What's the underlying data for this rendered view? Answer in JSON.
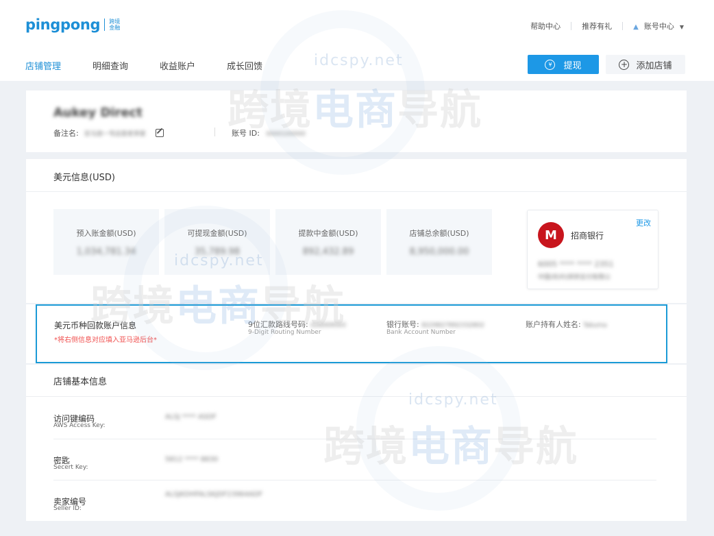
{
  "header": {
    "logo_word": "pingpong",
    "logo_sub": "跨境金融",
    "links": [
      "帮助中心",
      "推荐有礼"
    ],
    "account_menu": "账号中心",
    "nav_tabs": [
      {
        "label": "店铺管理",
        "active": true
      },
      {
        "label": "明细查询",
        "active": false
      },
      {
        "label": "收益账户",
        "active": false
      },
      {
        "label": "成长回馈",
        "active": false
      }
    ],
    "withdraw_label": "提现",
    "add_store_label": "添加店铺"
  },
  "store": {
    "name": "Aukey Direct",
    "remark_label": "备注名:",
    "remark_value": "亚马逊一号店是老李家",
    "account_label": "账号 ID:",
    "account_value": "0000100000"
  },
  "usd": {
    "title": "美元信息(USD)",
    "balances": [
      {
        "label": "预入账金额(USD)",
        "value": "1,034,781.34"
      },
      {
        "label": "可提现金额(USD)",
        "value": "35,789.98"
      },
      {
        "label": "提款中金额(USD)",
        "value": "892,432.89"
      },
      {
        "label": "店铺总余额(USD)",
        "value": "8,950,000.00"
      }
    ],
    "bank": {
      "change_label": "更改",
      "name": "招商银行",
      "number": "6005  ****  ****  2351",
      "sub": "中国(杭州)拼拼支付有限公"
    }
  },
  "receiving": {
    "title": "美元币种回款账户信息",
    "note": "*将右侧信息对应填入亚马逊后台*",
    "fields": [
      {
        "label": "9位汇款路线号码:",
        "value": "026009593",
        "sub": "9-Digit Routing Number"
      },
      {
        "label": "银行账号:",
        "value": "8229827892332802",
        "sub": "Bank Account Number"
      },
      {
        "label": "账户持有人姓名:",
        "value": "Takuma",
        "sub": ""
      }
    ]
  },
  "basic": {
    "title": "店铺基本信息",
    "rows": [
      {
        "label": "访问键编码",
        "sub": "AWS Access Key:",
        "value": "ALSJ ****  ASDF"
      },
      {
        "label": "密匙",
        "sub": "Secert Key:",
        "value": "5812 ****  8830"
      },
      {
        "label": "卖家编号",
        "sub": "Seller ID:",
        "value": "ALSJKDHFALSKJDF23964ADF"
      }
    ]
  },
  "watermark": {
    "domain": "idcspy.net",
    "text_pre": "跨境",
    "text_hl": "电商",
    "text_post": "导航"
  },
  "icons": {
    "withdraw": "yen-circle-icon",
    "add": "plus-circle-icon",
    "user": "user-icon",
    "edit": "edit-icon"
  },
  "colors": {
    "accent": "#1d98e6",
    "alert": "#f0504f",
    "bank_red": "#c8151d"
  }
}
